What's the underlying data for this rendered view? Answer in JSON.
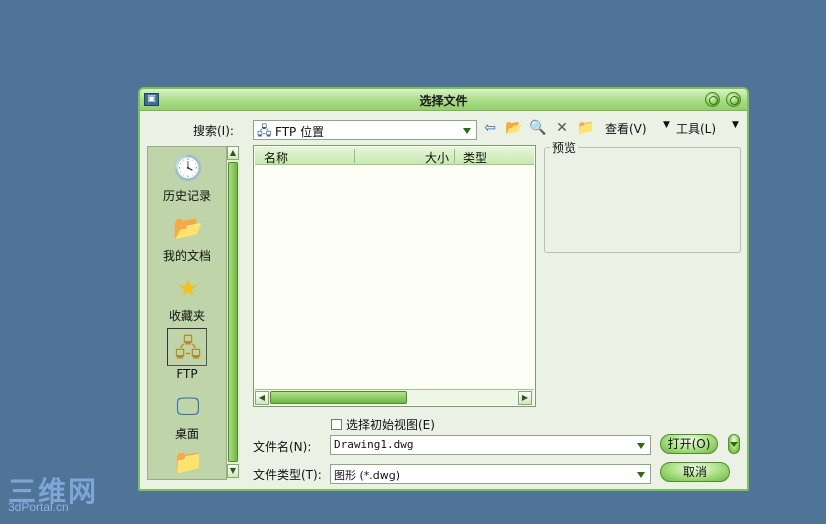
{
  "dialog": {
    "title": "选择文件",
    "search_label": "搜索(I):",
    "search_value": "FTP 位置",
    "view_label": "查看(V)",
    "tools_label": "工具(L)",
    "preview_label": "预览",
    "columns": [
      "名称",
      "大小",
      "类型"
    ],
    "places": [
      {
        "label": "历史记录",
        "icon": "history-icon"
      },
      {
        "label": "我的文档",
        "icon": "my-documents-icon"
      },
      {
        "label": "收藏夹",
        "icon": "favorites-icon"
      },
      {
        "label": "FTP",
        "icon": "ftp-icon"
      },
      {
        "label": "桌面",
        "icon": "desktop-icon"
      }
    ],
    "initial_view_label": "选择初始视图(E)",
    "filename_label": "文件名(N):",
    "filename_value": "Drawing1.dwg",
    "filetype_label": "文件类型(T):",
    "filetype_value": "图形 (*.dwg)",
    "open_label": "打开(O)",
    "cancel_label": "取消"
  },
  "watermark": {
    "line1": "三维网",
    "line2": "3dPortal.cn"
  }
}
